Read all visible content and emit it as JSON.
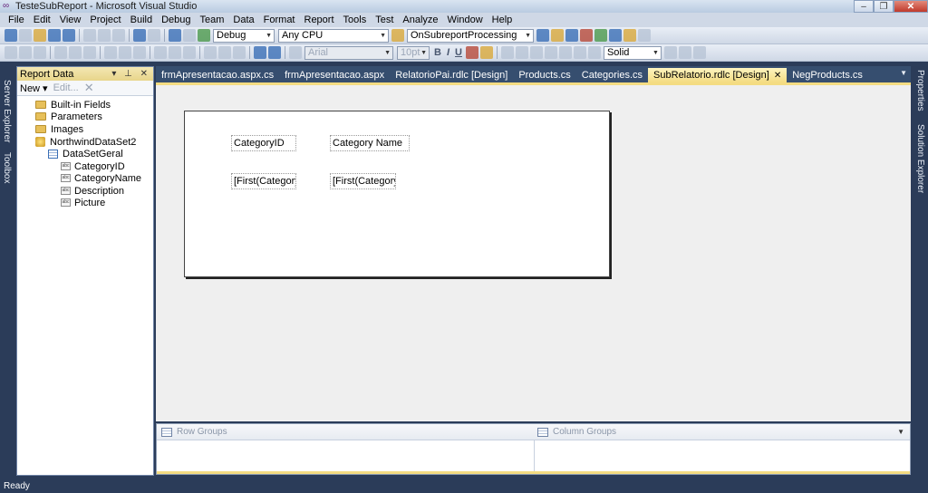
{
  "window": {
    "title": "TesteSubReport - Microsoft Visual Studio",
    "minimize": "–",
    "restore": "❐",
    "close": "✕"
  },
  "menu": [
    "File",
    "Edit",
    "View",
    "Project",
    "Build",
    "Debug",
    "Team",
    "Data",
    "Format",
    "Report",
    "Tools",
    "Test",
    "Analyze",
    "Window",
    "Help"
  ],
  "toolbar": {
    "config": "Debug",
    "platform": "Any CPU",
    "find": "OnSubreportProcessing",
    "font": "Arial",
    "font_size": "10pt",
    "bold": "B",
    "italic": "I",
    "underline": "U",
    "border_style": "Solid"
  },
  "left_strip": {
    "server_explorer": "Server Explorer",
    "toolbox": "Toolbox"
  },
  "right_strip": {
    "properties": "Properties",
    "solution_explorer": "Solution Explorer"
  },
  "report_data": {
    "title": "Report Data",
    "controls": "▾ ⊥ ✕",
    "new_label": "New ▾",
    "edit_label": "Edit...",
    "delete_label": "✕",
    "tree": {
      "builtin": "Built-in Fields",
      "parameters": "Parameters",
      "images": "Images",
      "dataset": "NorthwindDataSet2",
      "table": "DataSetGeral",
      "field_icon": "abc",
      "fields": [
        "CategoryID",
        "CategoryName",
        "Description",
        "Picture"
      ]
    }
  },
  "doc_tabs": {
    "items": [
      "frmApresentacao.aspx.cs",
      "frmApresentacao.aspx",
      "RelatorioPai.rdlc [Design]",
      "Products.cs",
      "Categories.cs",
      "SubRelatorio.rdlc [Design]",
      "NegProducts.cs"
    ],
    "active_close": "✕",
    "dropdown": "▼"
  },
  "report": {
    "header_1": "CategoryID",
    "header_2": "Category Name",
    "cell_1": "[First(CategoryI",
    "cell_2": "[First(CategoryI"
  },
  "groups": {
    "row_groups": "Row Groups",
    "column_groups": "Column Groups",
    "dropdown": "▼"
  },
  "status": {
    "text": "Ready"
  }
}
